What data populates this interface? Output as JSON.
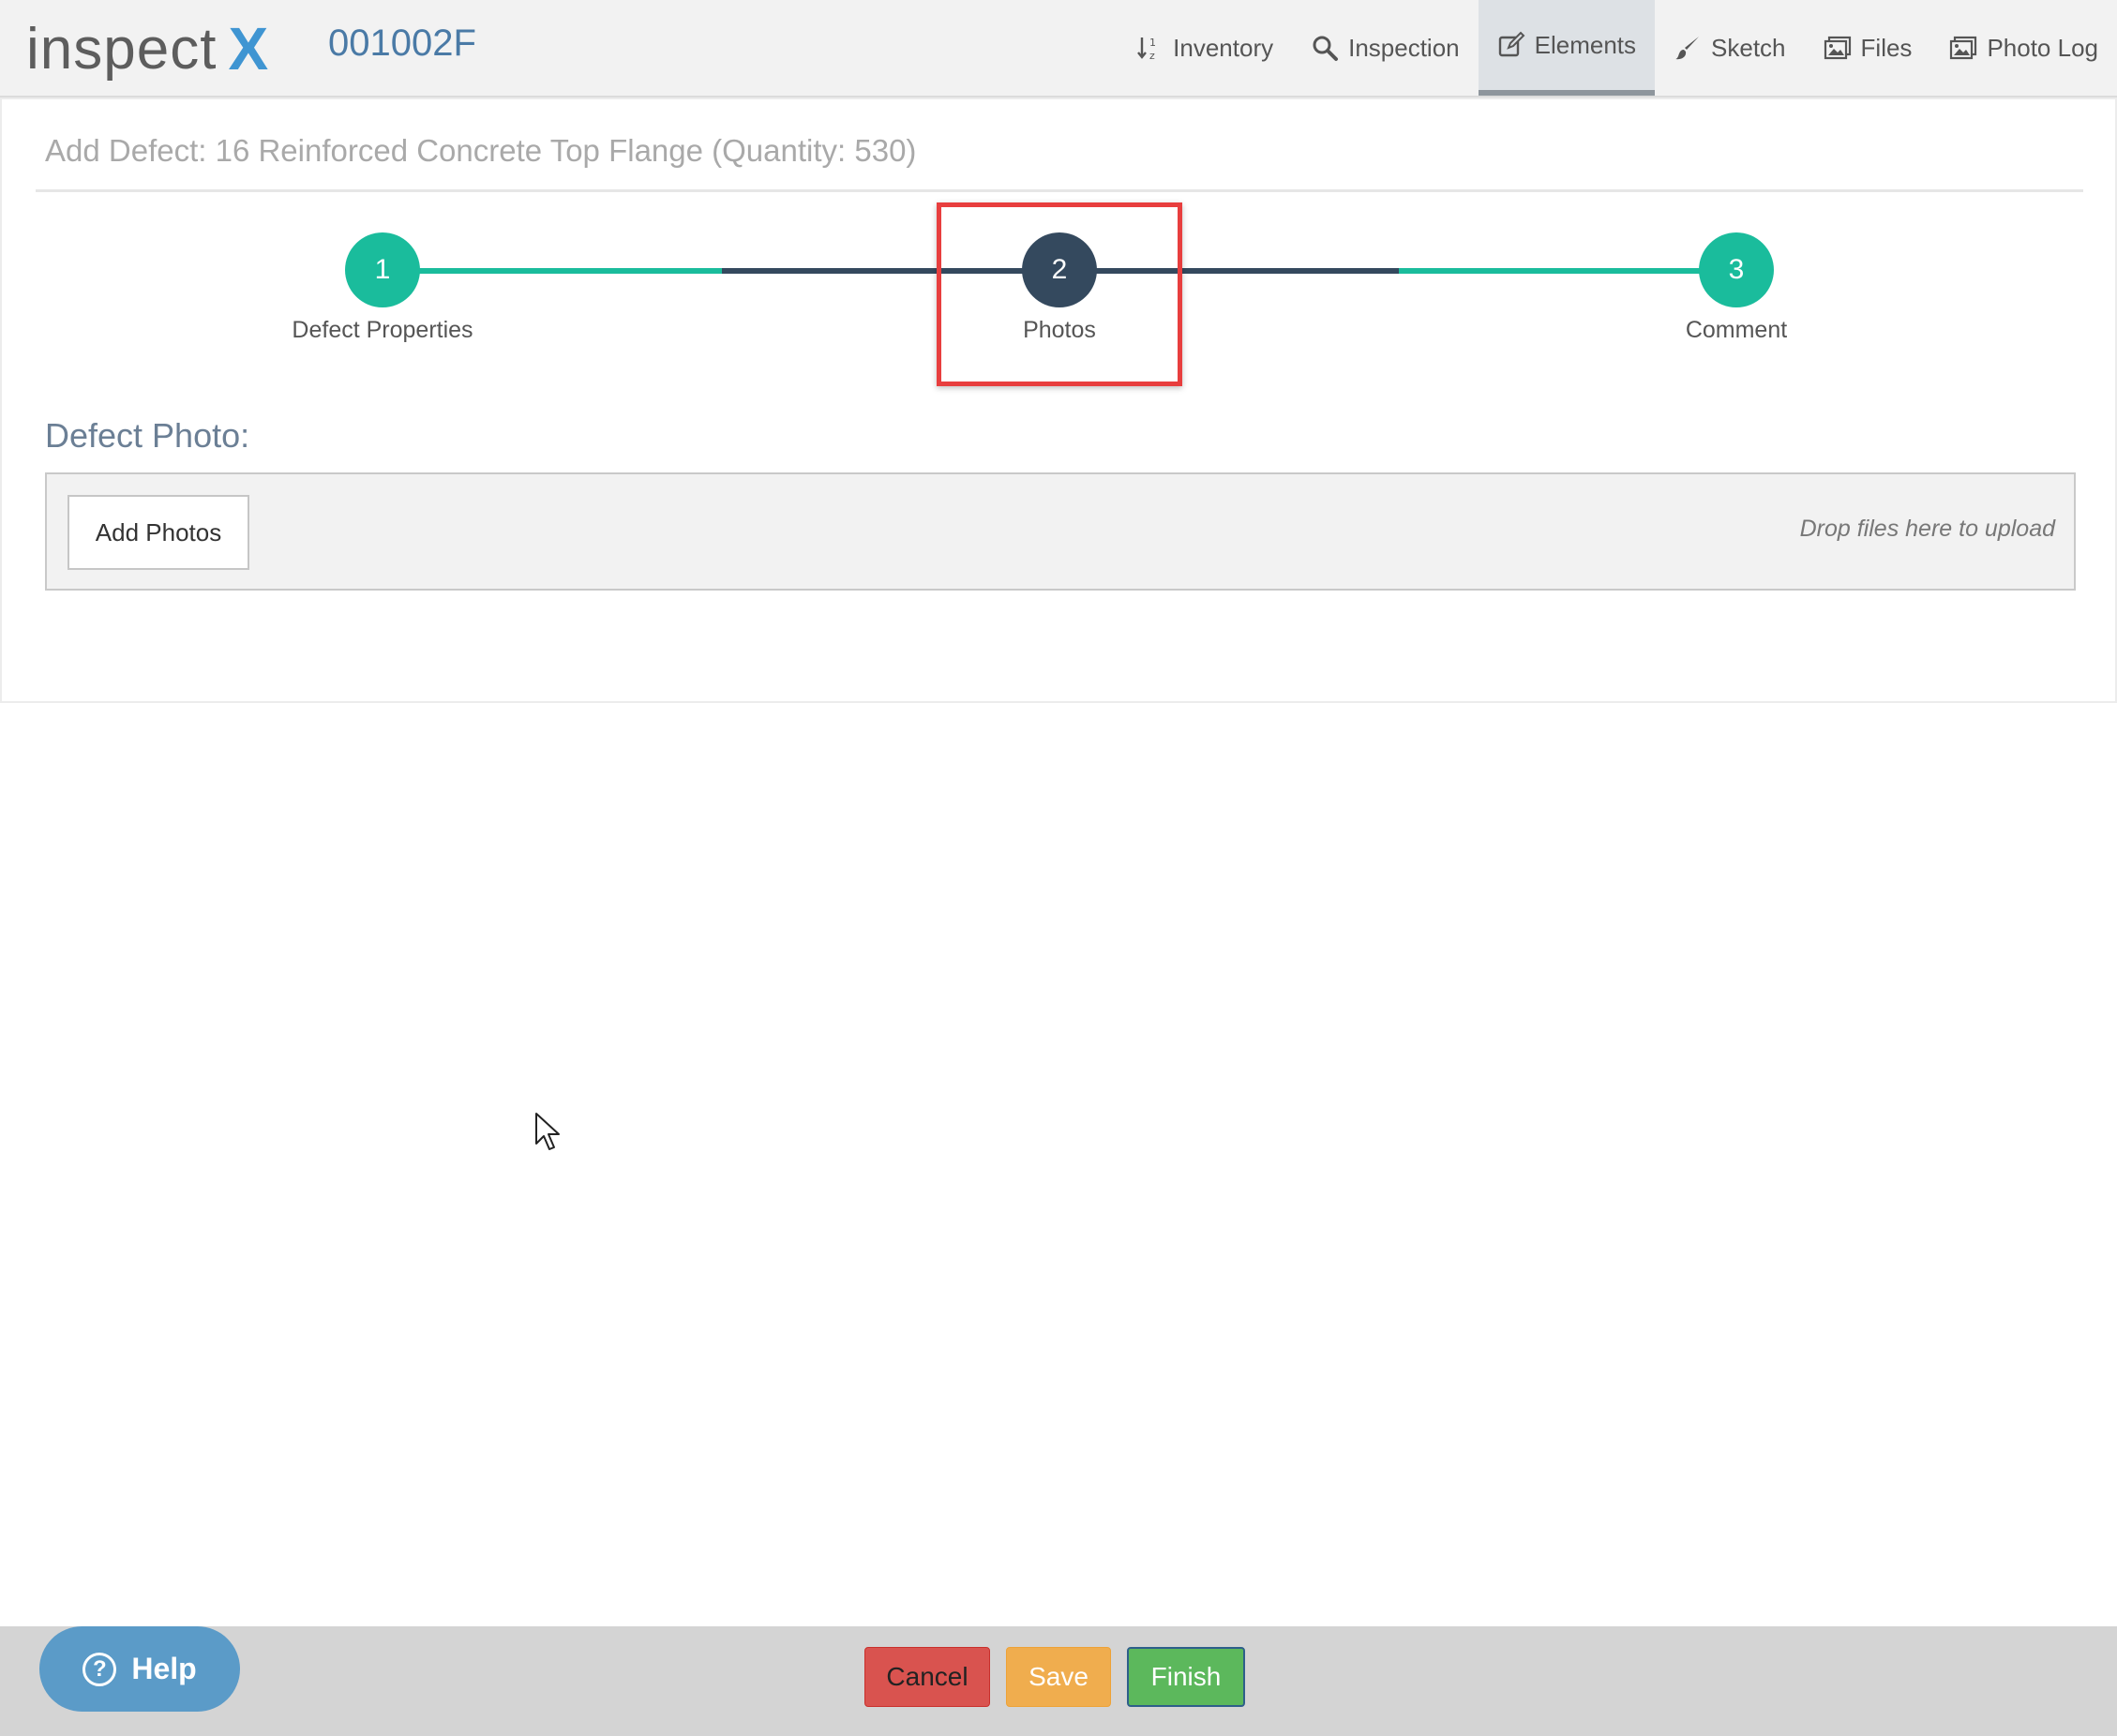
{
  "app": {
    "logo_text": "inspect",
    "logo_accent": "X",
    "structure_id": "001002F"
  },
  "nav": {
    "items": [
      {
        "label": "Inventory",
        "icon": "sort-icon"
      },
      {
        "label": "Inspection",
        "icon": "search-icon"
      },
      {
        "label": "Elements",
        "icon": "edit-icon",
        "active": true
      },
      {
        "label": "Sketch",
        "icon": "brush-icon"
      },
      {
        "label": "Files",
        "icon": "image-icon"
      },
      {
        "label": "Photo Log",
        "icon": "image-icon"
      }
    ]
  },
  "panel": {
    "title": "Add Defect: 16 Reinforced Concrete Top Flange (Quantity: 530)"
  },
  "wizard": {
    "steps": [
      {
        "number": "1",
        "label": "Defect Properties",
        "state": "complete"
      },
      {
        "number": "2",
        "label": "Photos",
        "state": "current"
      },
      {
        "number": "3",
        "label": "Comment",
        "state": "complete"
      }
    ],
    "colors": {
      "complete": "#1abc9c",
      "current": "#34495e",
      "highlight": "#e83e3e"
    }
  },
  "photo_section": {
    "label": "Defect Photo:",
    "add_button": "Add Photos",
    "drop_hint": "Drop files here to upload"
  },
  "footer": {
    "help": "Help",
    "cancel": "Cancel",
    "save": "Save",
    "finish": "Finish"
  }
}
